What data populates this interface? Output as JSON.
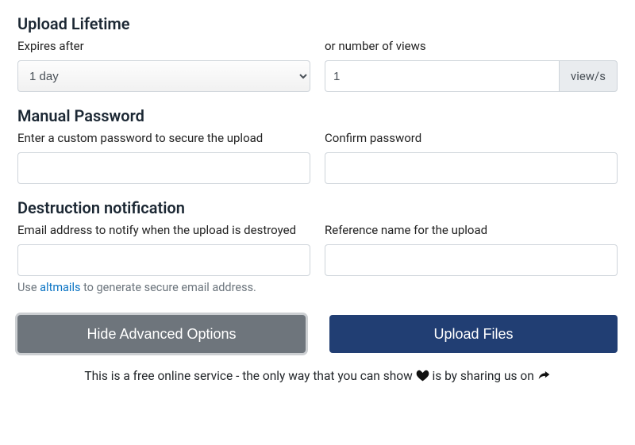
{
  "lifetime": {
    "title": "Upload Lifetime",
    "expires_label": "Expires after",
    "expires_value": "1 day",
    "views_label": "or number of views",
    "views_value": "1",
    "views_suffix": "view/s"
  },
  "password": {
    "title": "Manual Password",
    "enter_label": "Enter a custom password to secure the upload",
    "confirm_label": "Confirm password"
  },
  "destruction": {
    "title": "Destruction notification",
    "email_label": "Email address to notify when the upload is destroyed",
    "reference_label": "Reference name for the upload",
    "hint_prefix": "Use ",
    "hint_link": "altmails",
    "hint_suffix": " to generate secure email address."
  },
  "buttons": {
    "hide_advanced": "Hide Advanced Options",
    "upload": "Upload Files"
  },
  "footer": {
    "part1": "This is a free online service - the only way that you can show ",
    "part2": " is by sharing us on "
  }
}
